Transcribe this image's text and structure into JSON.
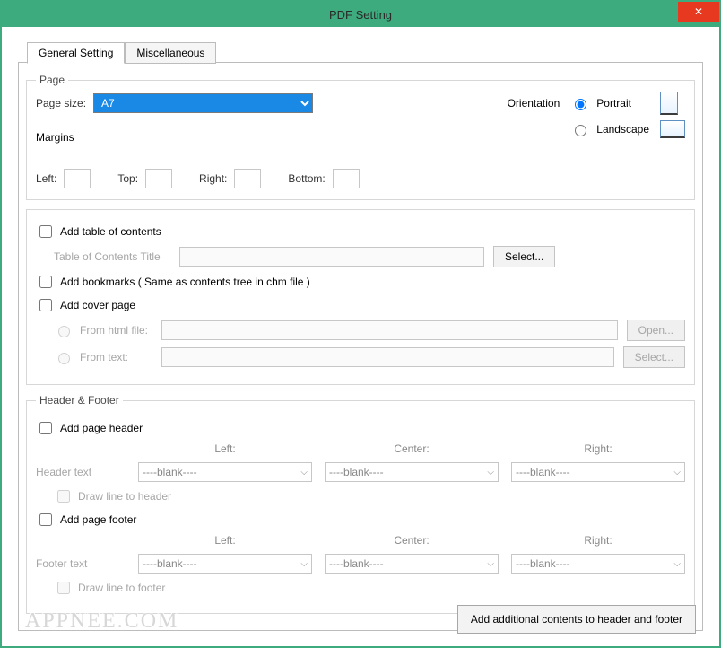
{
  "window": {
    "title": "PDF Setting"
  },
  "tabs": {
    "general": "General Setting",
    "misc": "Miscellaneous"
  },
  "page": {
    "legend": "Page",
    "size_label": "Page size:",
    "size_value": "A7",
    "orientation_label": "Orientation",
    "portrait_label": "Portrait",
    "landscape_label": "Landscape",
    "margins_label": "Margins",
    "left_label": "Left:",
    "top_label": "Top:",
    "right_label": "Right:",
    "bottom_label": "Bottom:",
    "left": "",
    "top": "",
    "right": "",
    "bottom": ""
  },
  "toc": {
    "add_label": "Add table of contents",
    "title_label": "Table of Contents Title",
    "title_value": "",
    "select_btn": "Select..."
  },
  "bookmarks": {
    "add_label": "Add  bookmarks ( Same as contents tree in chm file )"
  },
  "cover": {
    "add_label": "Add cover page",
    "from_html_label": "From html file:",
    "from_text_label": "From  text:",
    "html_value": "",
    "text_value": "",
    "open_btn": "Open...",
    "select_btn": "Select..."
  },
  "hf": {
    "legend": "Header & Footer",
    "add_header_label": "Add page header",
    "add_footer_label": "Add page footer",
    "col_left": "Left:",
    "col_center": "Center:",
    "col_right": "Right:",
    "header_text_label": "Header text",
    "footer_text_label": "Footer text",
    "blank": "----blank----",
    "draw_header_label": "Draw line to header",
    "draw_footer_label": "Draw line to footer"
  },
  "bottom_button": "Add additional contents to header and footer",
  "watermark": "APPNEE.COM"
}
